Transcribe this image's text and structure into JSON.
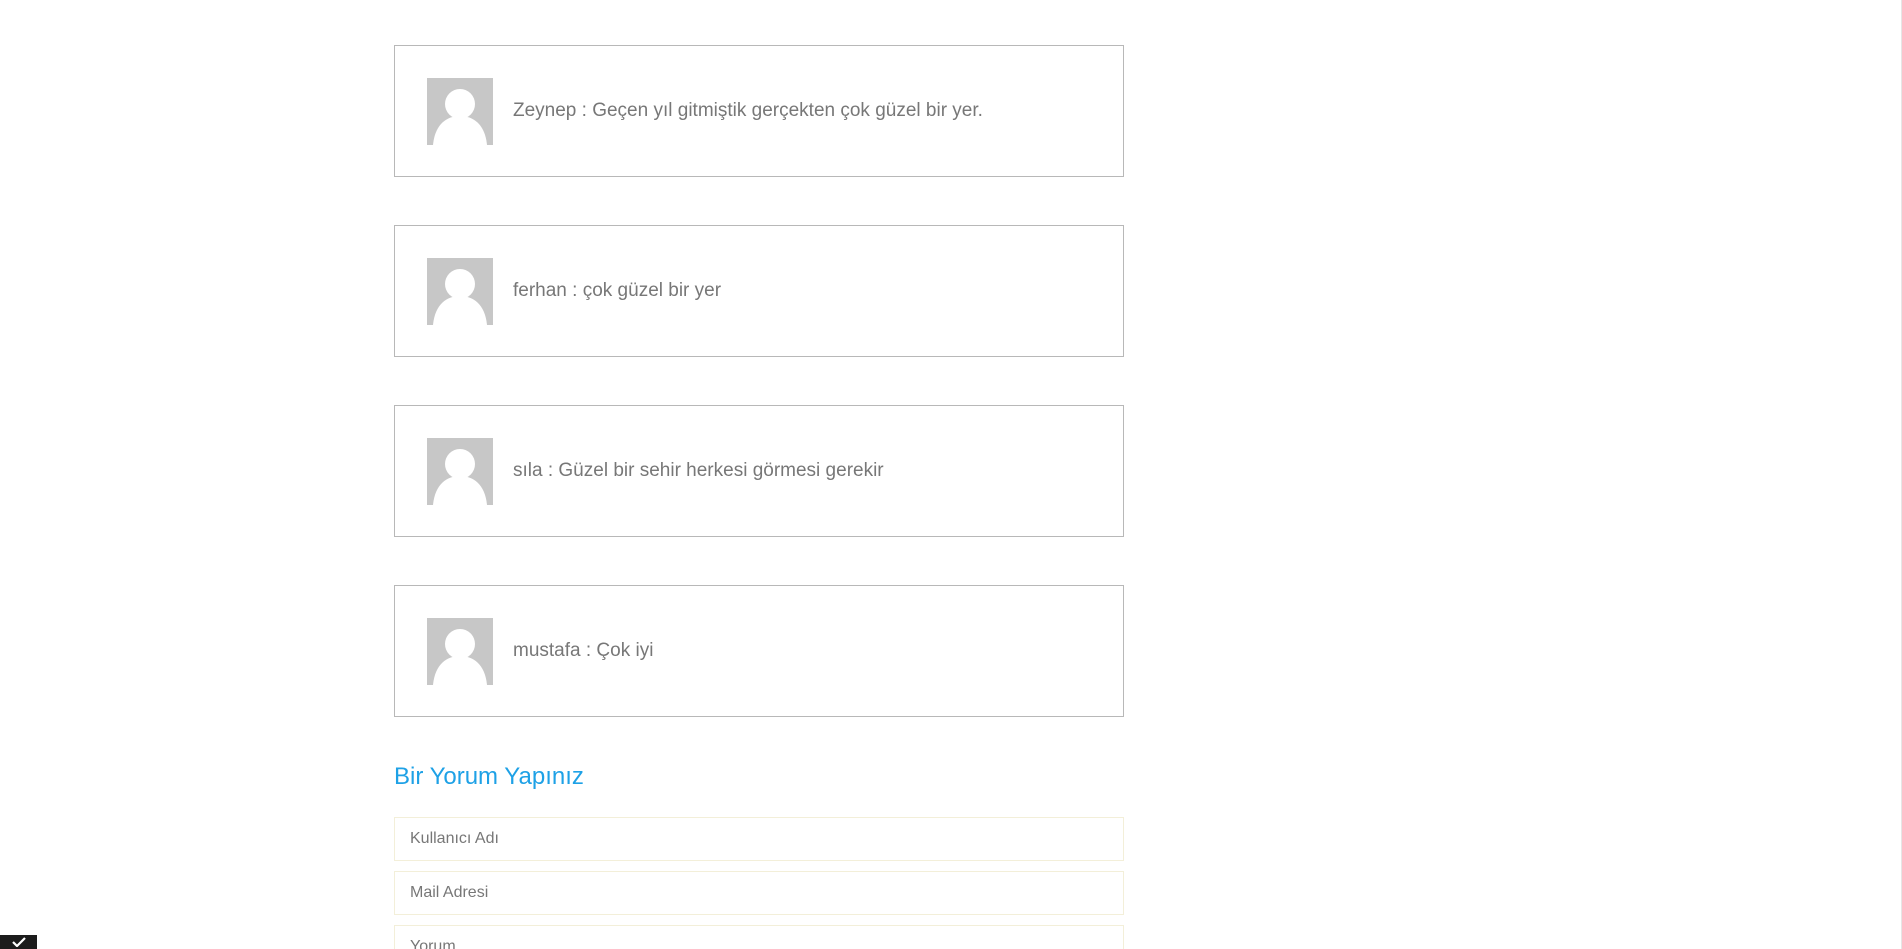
{
  "comments": [
    {
      "text": "Zeynep : Geçen yıl gitmiştik gerçekten çok güzel bir yer."
    },
    {
      "text": "ferhan : çok güzel bir yer"
    },
    {
      "text": "sıla : Güzel bir sehir herkesi görmesi gerekir"
    },
    {
      "text": "mustafa : Çok iyi"
    }
  ],
  "form": {
    "title": "Bir Yorum Yapınız",
    "username_placeholder": "Kullanıcı Adı",
    "email_placeholder": "Mail Adresi",
    "comment_placeholder": "Yorum"
  },
  "colors": {
    "accent": "#1ea1e6",
    "avatar_bg": "#c7c7c7",
    "border": "#b8b8b8",
    "text": "#777777"
  },
  "icons": {
    "avatar": "default-user-avatar-icon",
    "corner": "check-mark-icon"
  }
}
